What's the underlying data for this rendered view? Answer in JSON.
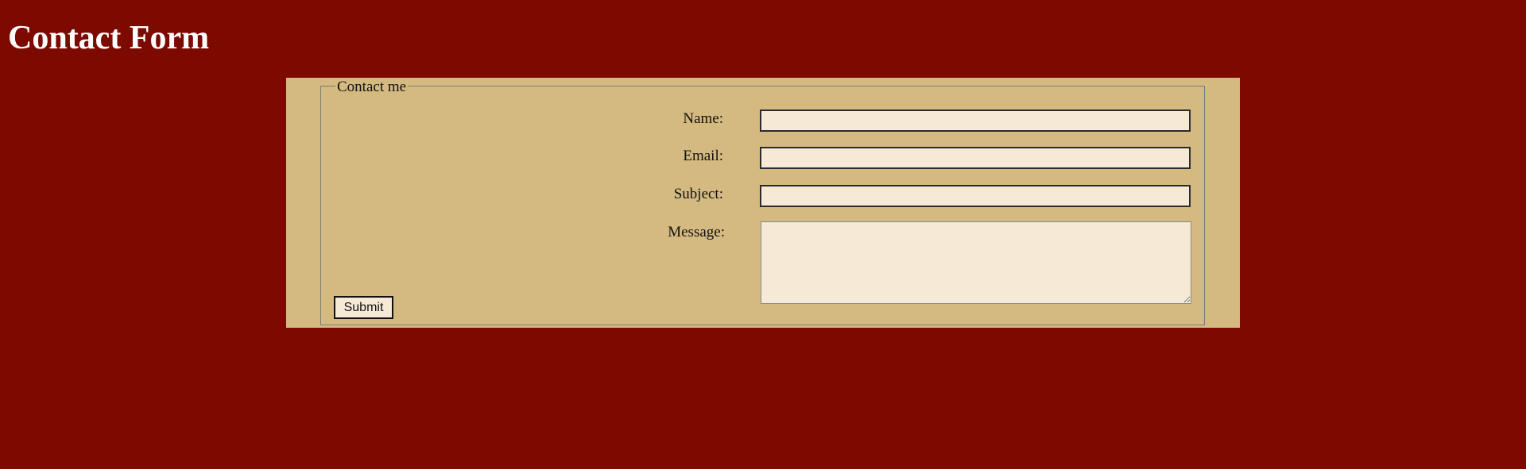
{
  "page": {
    "title": "Contact Form"
  },
  "form": {
    "legend": "Contact me",
    "fields": {
      "name": {
        "label": "Name:",
        "value": ""
      },
      "email": {
        "label": "Email:",
        "value": ""
      },
      "subject": {
        "label": "Subject:",
        "value": ""
      },
      "message": {
        "label": "Message:",
        "value": ""
      }
    },
    "submit_label": "Submit"
  },
  "colors": {
    "page_background": "#7d0a00",
    "panel_background": "#d4ba80",
    "input_background": "#f6ead6",
    "title_text": "#ffffff"
  }
}
